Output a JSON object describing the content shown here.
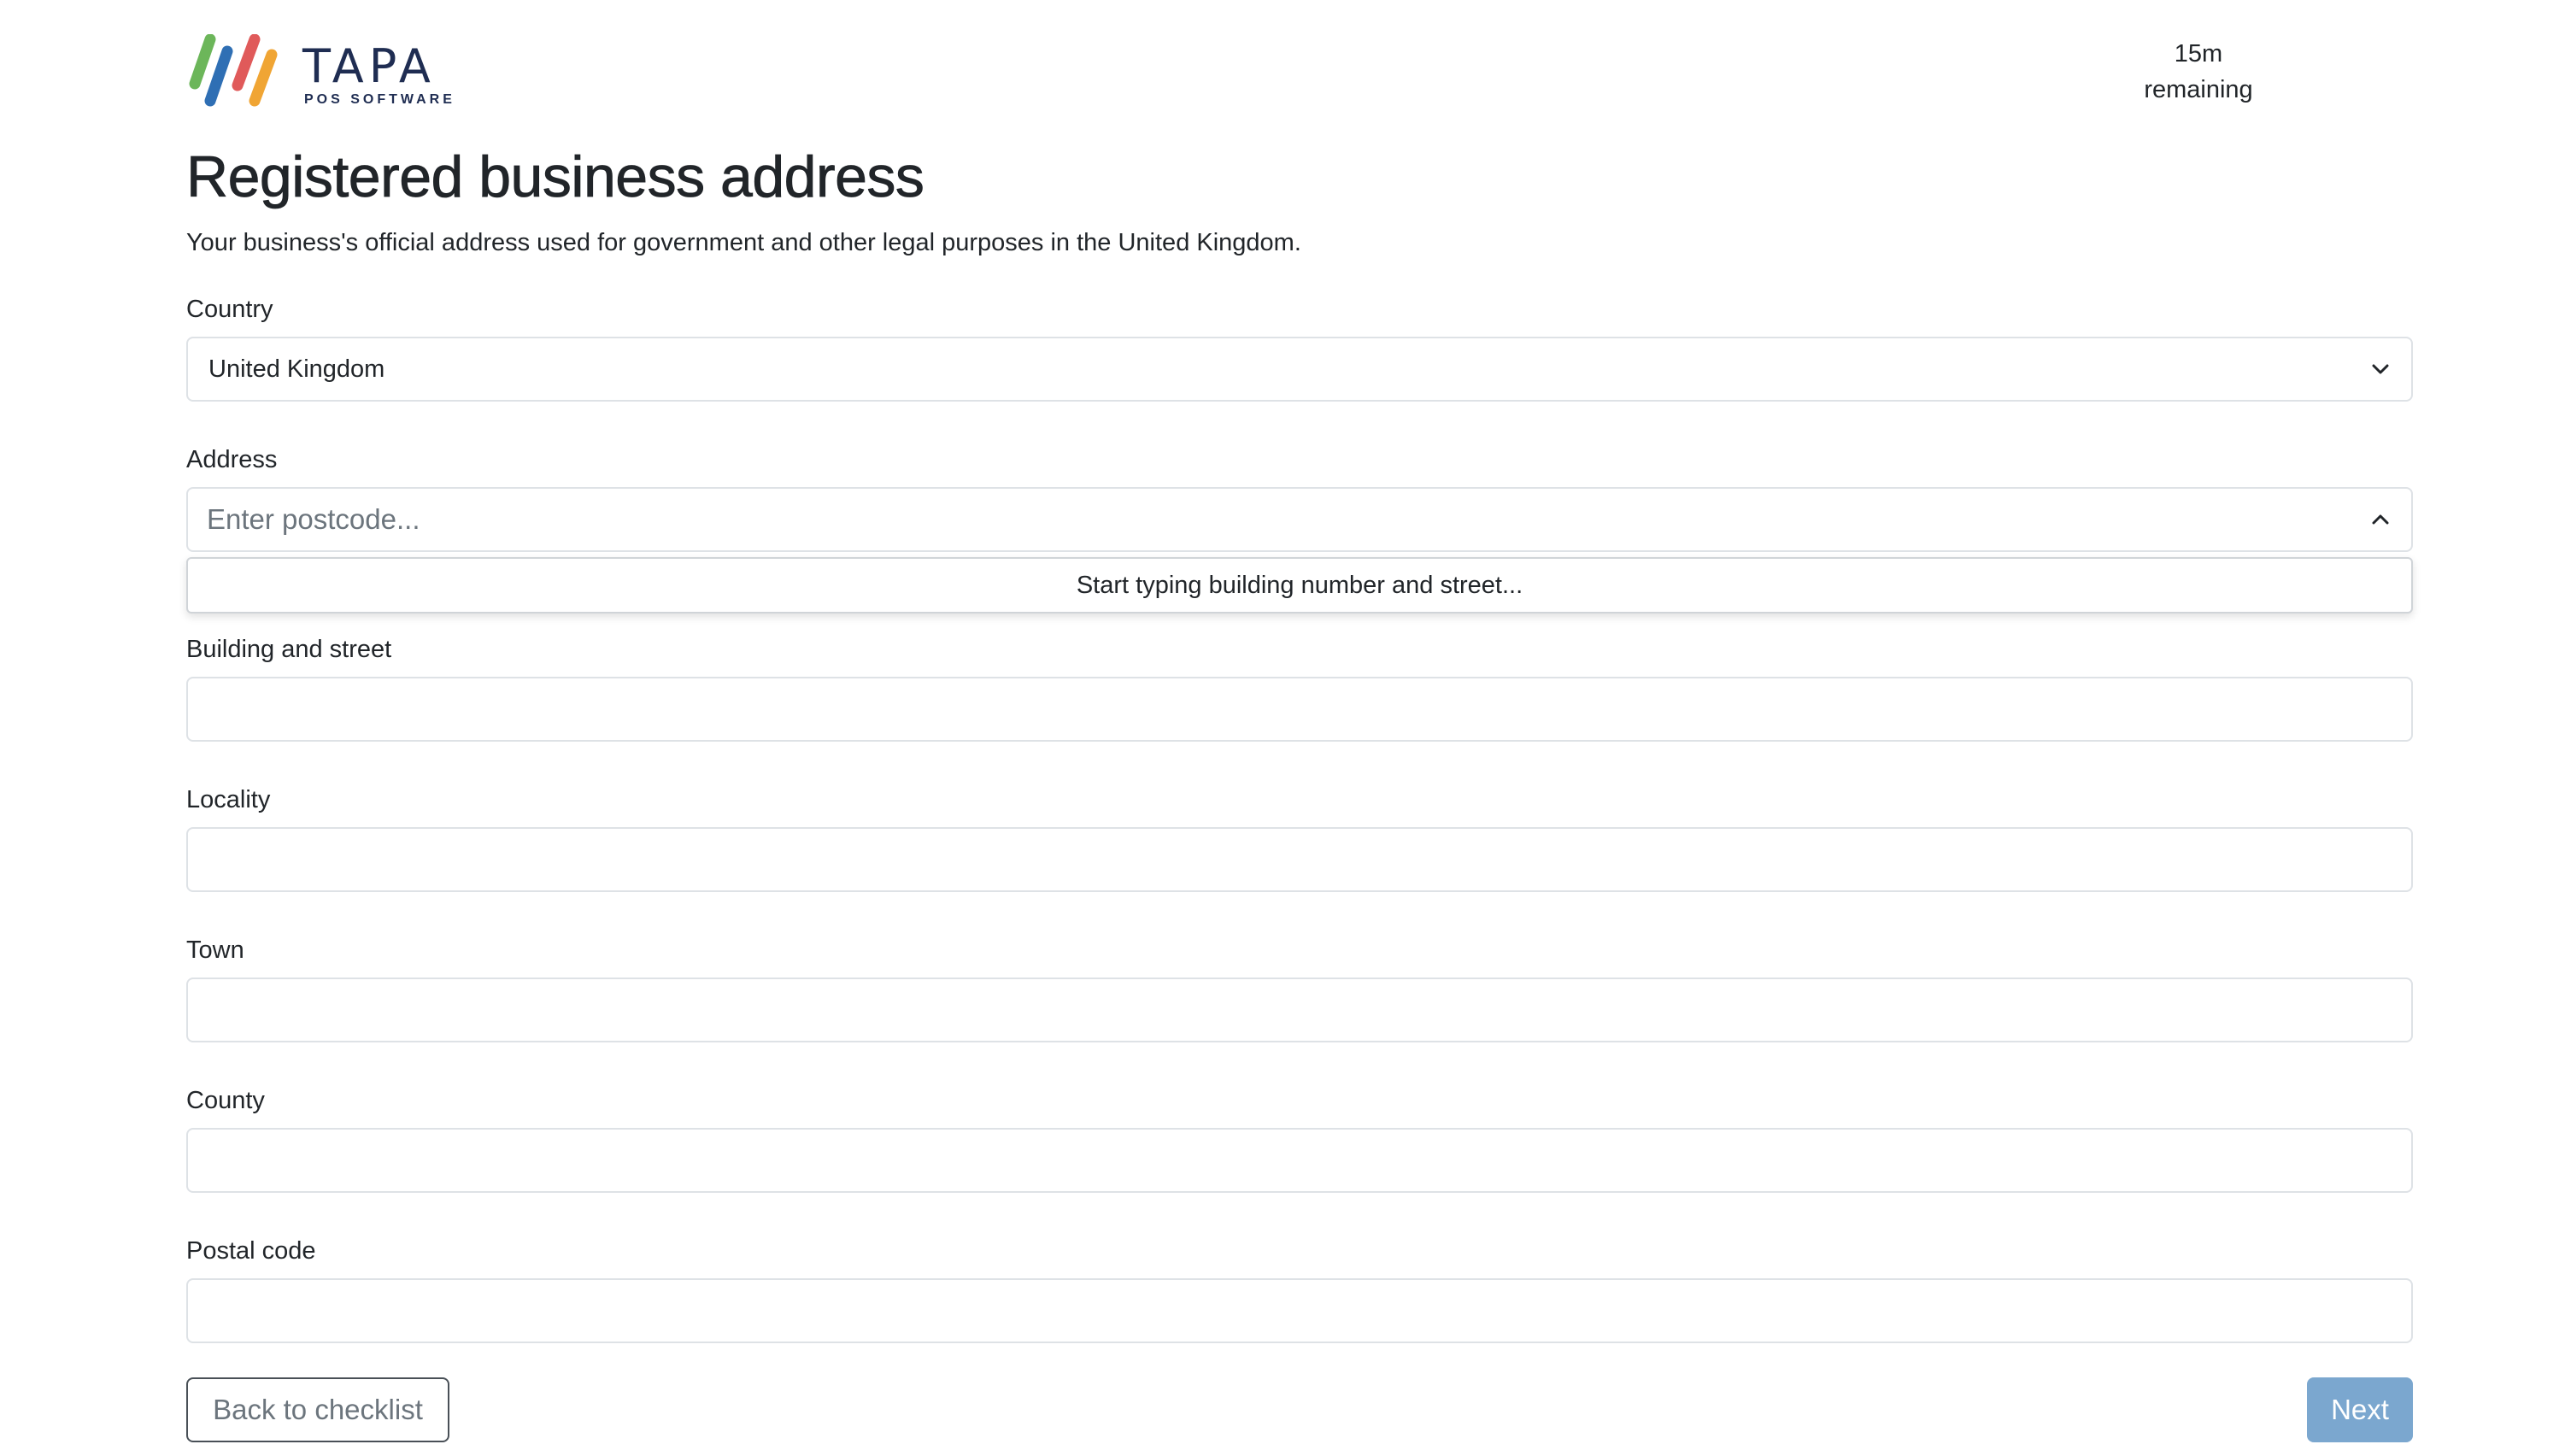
{
  "header": {
    "brand_name": "TAPA",
    "brand_sub": "POS SOFTWARE",
    "timer_value": "15m",
    "timer_label": "remaining"
  },
  "main": {
    "title": "Registered business address",
    "subtitle": "Your business's official address used for government and other legal purposes in the United Kingdom."
  },
  "form": {
    "country": {
      "label": "Country",
      "value": "United Kingdom",
      "icon": "chevron-down-icon"
    },
    "address": {
      "label": "Address",
      "placeholder": "Enter postcode...",
      "icon": "chevron-up-icon",
      "dropdown_hint": "Start typing building number and street..."
    },
    "building_street": {
      "label": "Building and street",
      "value": ""
    },
    "locality": {
      "label": "Locality",
      "value": ""
    },
    "town": {
      "label": "Town",
      "value": ""
    },
    "county": {
      "label": "County",
      "value": ""
    },
    "postal_code": {
      "label": "Postal code",
      "value": ""
    }
  },
  "footer": {
    "back_label": "Back to checklist",
    "next_label": "Next"
  },
  "colors": {
    "brand_navy": "#1f2d52",
    "logo_green": "#6cb65a",
    "logo_blue": "#2f6fb4",
    "logo_red": "#e05a5a",
    "logo_orange": "#f0a534",
    "next_button": "#7ba7cf",
    "field_border": "#dee2e6"
  }
}
